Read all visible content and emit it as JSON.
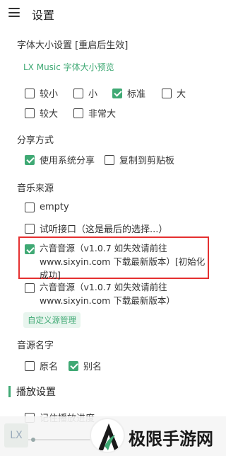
{
  "header": {
    "title": "设置"
  },
  "font_size": {
    "label": "字体大小设置 [重启后生效]",
    "preview_link": "LX Music 字体大小预览",
    "options": [
      {
        "label": "较小",
        "checked": false
      },
      {
        "label": "小",
        "checked": false
      },
      {
        "label": "标准",
        "checked": true
      },
      {
        "label": "大",
        "checked": false
      },
      {
        "label": "较大",
        "checked": false
      },
      {
        "label": "非常大",
        "checked": false
      }
    ]
  },
  "share": {
    "label": "分享方式",
    "options": [
      {
        "label": "使用系统分享",
        "checked": true
      },
      {
        "label": "复制到剪贴板",
        "checked": false
      }
    ]
  },
  "music_source": {
    "label": "音乐来源",
    "options": [
      {
        "label": "empty",
        "checked": false
      },
      {
        "label": "试听接口（这是最后的选择...）",
        "checked": false
      },
      {
        "label": "六音音源（v1.0.7 如失效请前往\nwww.sixyin.com 下载最新版本）[初始化成功]",
        "checked": true
      },
      {
        "label": "六音音源（v1.0.7 如失效请前往\nwww.sixyin.com 下载最新版本）",
        "checked": false
      }
    ],
    "custom_button": "自定义源管理"
  },
  "source_name": {
    "label": "音源名字",
    "options": [
      {
        "label": "原名",
        "checked": false
      },
      {
        "label": "别名",
        "checked": true
      }
    ]
  },
  "playback": {
    "heading": "播放设置",
    "options": [
      {
        "label": "记住播放进度",
        "checked": false
      }
    ]
  },
  "player_bar": {
    "logo_text": "LX"
  },
  "watermark": {
    "text": "极限手游网"
  },
  "colors": {
    "accent": "#3fa974",
    "highlight_border": "#e53030"
  }
}
